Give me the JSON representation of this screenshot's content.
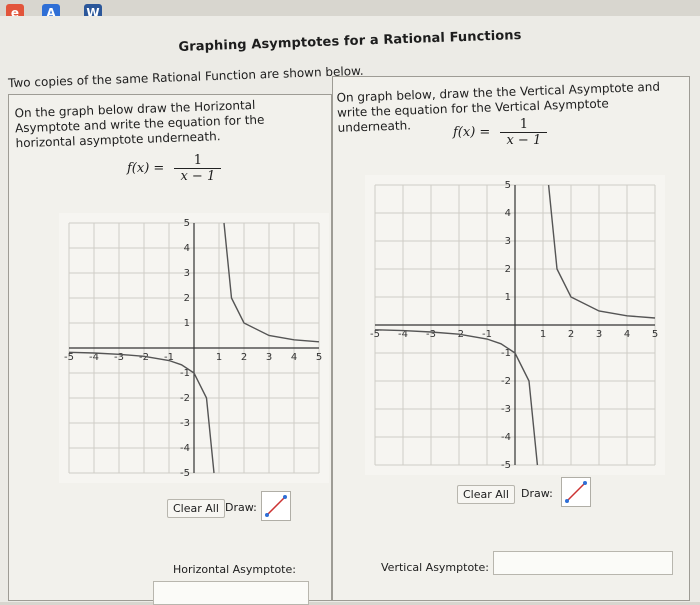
{
  "toolbar": {
    "icons": [
      {
        "name": "edge-icon",
        "glyph": "e",
        "color": "#e2553b"
      },
      {
        "name": "app-icon",
        "glyph": "A",
        "color": "#2f6fd6"
      },
      {
        "name": "word-icon",
        "glyph": "W",
        "color": "#2b579a"
      }
    ]
  },
  "page": {
    "title": "Graphing Asymptotes for a Rational Functions",
    "subtitle": "Two copies of the same Rational Function are shown below."
  },
  "left": {
    "instruction": "On the graph below draw the Horizontal Asymptote and write the equation for the horizontal asymptote underneath.",
    "fx_lhs": "f(x) =",
    "fx_num": "1",
    "fx_den": "x − 1",
    "clear_label": "Clear All",
    "draw_label": "Draw:",
    "answer_label": "Horizontal Asymptote:",
    "answer_value": ""
  },
  "right": {
    "instruction": "On graph below, draw the the Vertical Asymptote and write the equation for the Vertical Asymptote underneath.",
    "fx_lhs": "f(x) =",
    "fx_num": "1",
    "fx_den": "x − 1",
    "clear_label": "Clear All",
    "draw_label": "Draw:",
    "answer_label": "Vertical Asymptote:",
    "answer_value": ""
  },
  "chart_data": [
    {
      "type": "line",
      "function": "f(x) = 1/(x - 1)",
      "xlim": [
        -5,
        5
      ],
      "ylim": [
        -5,
        5
      ],
      "x_ticks": [
        -5,
        -4,
        -3,
        -2,
        -1,
        1,
        2,
        3,
        4,
        5
      ],
      "y_ticks": [
        -5,
        -4,
        -3,
        -2,
        -1,
        1,
        2,
        3,
        4,
        5
      ],
      "grid": true,
      "series": [
        {
          "x": [
            -5,
            -4,
            -3,
            -2,
            -1,
            -0.5,
            0,
            0.5,
            0.8
          ],
          "y": [
            -0.17,
            -0.2,
            -0.25,
            -0.33,
            -0.5,
            -0.67,
            -1,
            -2,
            -5
          ]
        },
        {
          "x": [
            1.2,
            1.5,
            2,
            3,
            4,
            5
          ],
          "y": [
            5,
            2,
            1,
            0.5,
            0.33,
            0.25
          ]
        }
      ]
    },
    {
      "type": "line",
      "function": "f(x) = 1/(x - 1)",
      "xlim": [
        -5,
        5
      ],
      "ylim": [
        -5,
        5
      ],
      "x_ticks": [
        -5,
        -4,
        -3,
        -2,
        -1,
        1,
        2,
        3,
        4,
        5
      ],
      "y_ticks": [
        -5,
        -4,
        -3,
        -2,
        -1,
        1,
        2,
        3,
        4,
        5
      ],
      "grid": true,
      "series": [
        {
          "x": [
            -5,
            -4,
            -3,
            -2,
            -1,
            -0.5,
            0,
            0.5,
            0.8
          ],
          "y": [
            -0.17,
            -0.2,
            -0.25,
            -0.33,
            -0.5,
            -0.67,
            -1,
            -2,
            -5
          ]
        },
        {
          "x": [
            1.2,
            1.5,
            2,
            3,
            4,
            5
          ],
          "y": [
            5,
            2,
            1,
            0.5,
            0.33,
            0.25
          ]
        }
      ]
    }
  ]
}
